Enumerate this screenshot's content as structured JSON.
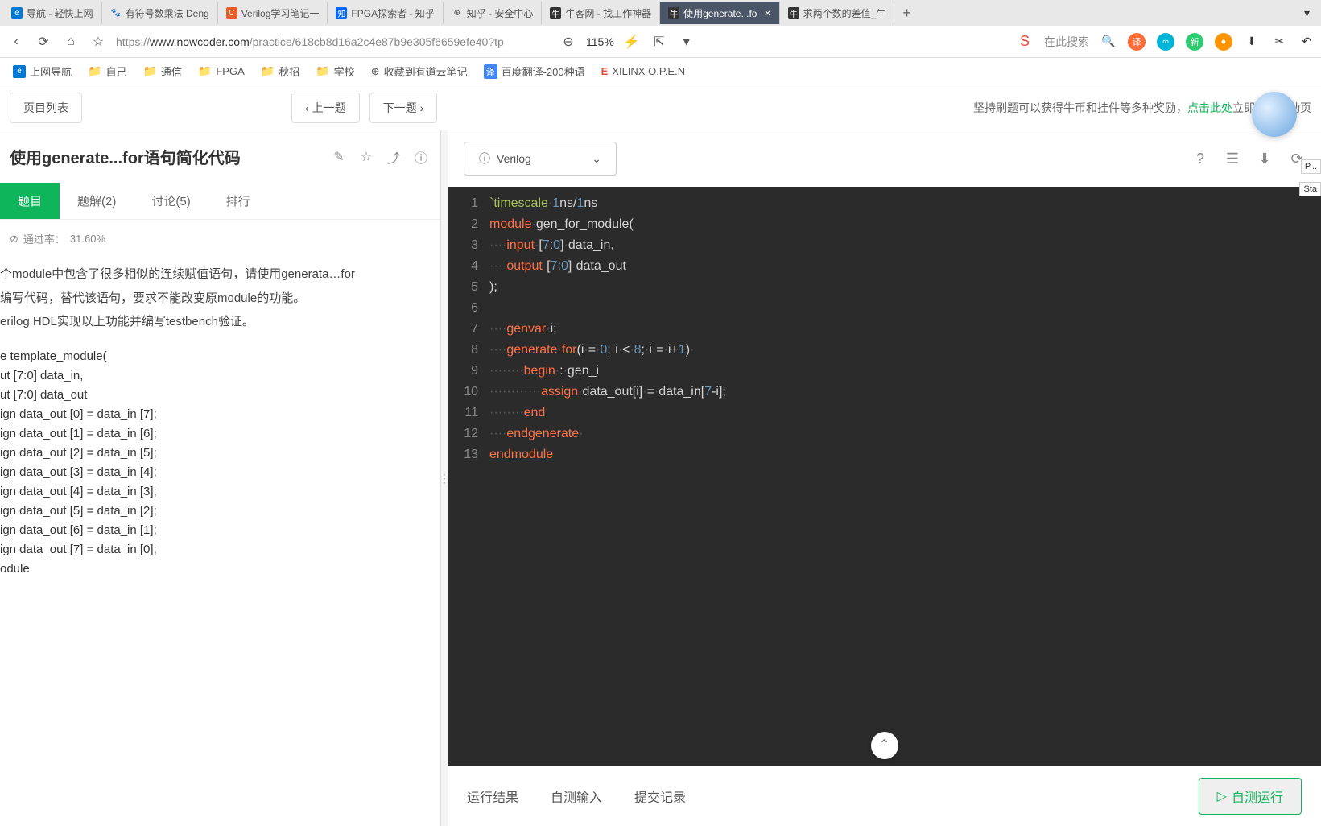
{
  "browser": {
    "tabs": [
      {
        "icon": "e",
        "label": "导航 - 轻快上网"
      },
      {
        "icon": "🐾",
        "label": "有符号数乘法 Deng"
      },
      {
        "icon": "C",
        "label": "Verilog学习笔记一"
      },
      {
        "icon": "知",
        "label": "FPGA探索者 - 知乎"
      },
      {
        "icon": "⊕",
        "label": "知乎 - 安全中心"
      },
      {
        "icon": "牛",
        "label": "牛客网 - 找工作神器"
      },
      {
        "icon": "牛",
        "label": "使用generate...fo",
        "active": true
      },
      {
        "icon": "牛",
        "label": "求两个数的差值_牛"
      }
    ],
    "url_prefix": "https://",
    "url_domain": "www.nowcoder.com",
    "url_path": "/practice/618cb8d16a2c4e87b9e305f6659efe40?tp",
    "zoom": "115%",
    "search_placeholder": "在此搜索"
  },
  "bookmarks": [
    {
      "icon": "e",
      "label": "上网导航"
    },
    {
      "icon": "folder",
      "label": "自己"
    },
    {
      "icon": "folder",
      "label": "通信"
    },
    {
      "icon": "folder",
      "label": "FPGA"
    },
    {
      "icon": "folder",
      "label": "秋招"
    },
    {
      "icon": "folder",
      "label": "学校"
    },
    {
      "icon": "⊕",
      "label": "收藏到有道云笔记"
    },
    {
      "icon": "译",
      "label": "百度翻译-200种语"
    },
    {
      "icon": "E",
      "label": "XILINX O.P.E.N"
    }
  ],
  "header": {
    "list_btn": "页目列表",
    "prev_btn": "上一题",
    "next_btn": "下一题",
    "reward_text": "坚持刷题可以获得牛币和挂件等多种奖励，",
    "reward_link": "点击此处",
    "reward_suffix": "立即参与活动页"
  },
  "problem": {
    "title": "使用generate...for语句简化代码",
    "tabs": [
      {
        "label": "题目",
        "active": true
      },
      {
        "label": "题解(2)"
      },
      {
        "label": "讨论(5)"
      },
      {
        "label": "排行"
      }
    ],
    "pass_label": "通过率：",
    "pass_rate": "31.60%",
    "desc1": "个module中包含了很多相似的连续赋值语句，请使用generata…for",
    "desc2": "编写代码，替代该语句，要求不能改变原module的功能。",
    "desc3": "erilog HDL实现以上功能并编写testbench验证。",
    "code_lines": [
      "e template_module(",
      "ut [7:0] data_in,",
      "ut [7:0] data_out",
      "",
      "ign data_out [0] = data_in [7];",
      "ign data_out [1] = data_in [6];",
      "ign data_out [2] = data_in [5];",
      "ign data_out [3] = data_in [4];",
      "ign data_out [4] = data_in [3];",
      "ign data_out [5] = data_in [2];",
      "ign data_out [6] = data_in [1];",
      "ign data_out [7] = data_in [0];",
      "",
      "odule"
    ]
  },
  "editor": {
    "language": "Verilog",
    "lines_count": 13
  },
  "results": {
    "tabs": [
      "运行结果",
      "自测输入",
      "提交记录"
    ],
    "run_btn": "自测运行"
  },
  "edge_labels": {
    "p": "P...",
    "sta": "Sta"
  }
}
